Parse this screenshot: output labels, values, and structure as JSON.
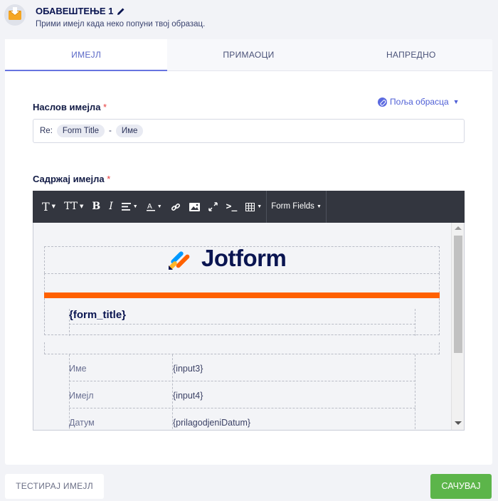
{
  "header": {
    "title": "ОБАВЕШТЕЊЕ 1",
    "subtitle": "Прими имејл када неко попуни твој образац."
  },
  "tabs": [
    {
      "label": "ИМЕЈЛ",
      "active": true
    },
    {
      "label": "ПРИМАОЦИ",
      "active": false
    },
    {
      "label": "НАПРЕДНО",
      "active": false
    }
  ],
  "subject": {
    "label": "Наслов имејла",
    "required": "*",
    "prefix": "Re:",
    "tag1": "Form Title",
    "separator": "-",
    "tag2": "Име"
  },
  "form_fields_link": "Поља обрасца",
  "content": {
    "label": "Садржај имејла",
    "required": "*"
  },
  "toolbar": {
    "font": "T",
    "font_size": "TT",
    "bold": "B",
    "italic": "I",
    "form_fields": "Form Fields"
  },
  "email_preview": {
    "logo_text": "Jotform",
    "form_title": "{form_title}",
    "rows": [
      {
        "label": "Име",
        "value": "{input3}"
      },
      {
        "label": "Имејл",
        "value": "{input4}"
      },
      {
        "label": "Датум",
        "value": "{prilagodjeniDatum}"
      }
    ],
    "colors": {
      "orange": "#ff6100",
      "navy": "#0a1551"
    }
  },
  "buttons": {
    "test": "ТЕСТИРАЈ ИМЕЈЛ",
    "save": "САЧУВАЈ"
  }
}
